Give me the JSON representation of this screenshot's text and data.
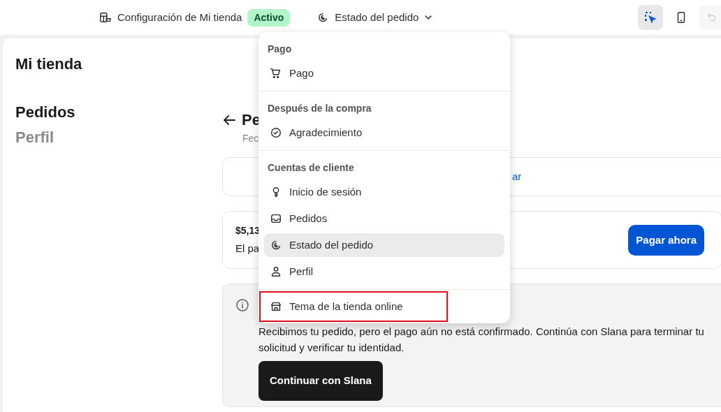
{
  "topbar": {
    "store_title": "Configuración de Mi tienda",
    "status_badge": "Activo",
    "page_selector": "Estado del pedido",
    "inspector_selected": true,
    "undo_disabled": true
  },
  "store_name": "Mi tienda",
  "side_nav": [
    {
      "label": "Pedidos",
      "selected": true
    },
    {
      "label": "Perfil",
      "selected": false
    }
  ],
  "order": {
    "title": "Pe",
    "subtitle": "Fec",
    "link": "ar",
    "amount": "$5,13",
    "note": "El pa",
    "pay_button": "Pagar ahora",
    "notice": {
      "text": "Recibimos tu pedido, pero el pago aún no está confirmado. Continúa con Slana para terminar tu solicitud y verificar tu identidad.",
      "button": "Continuar con Slana"
    }
  },
  "menu": {
    "sections": [
      {
        "heading": "Pago",
        "items": [
          {
            "label": "Pago",
            "kind": "cart",
            "selected": false,
            "highlighted": false
          }
        ]
      },
      {
        "heading": "Después de la compra",
        "items": [
          {
            "label": "Agradecimiento",
            "kind": "check",
            "selected": false,
            "highlighted": false
          }
        ]
      },
      {
        "heading": "Cuentas de cliente",
        "items": [
          {
            "label": "Inicio de sesión",
            "kind": "key",
            "selected": false,
            "highlighted": false
          },
          {
            "label": "Pedidos",
            "kind": "inbox",
            "selected": false,
            "highlighted": false
          },
          {
            "label": "Estado del pedido",
            "kind": "status",
            "selected": true,
            "highlighted": false
          },
          {
            "label": "Perfil",
            "kind": "person",
            "selected": false,
            "highlighted": false
          }
        ]
      },
      {
        "items": [
          {
            "label": "Tema de la tienda online",
            "kind": "store",
            "selected": false,
            "highlighted": true
          }
        ]
      }
    ]
  }
}
